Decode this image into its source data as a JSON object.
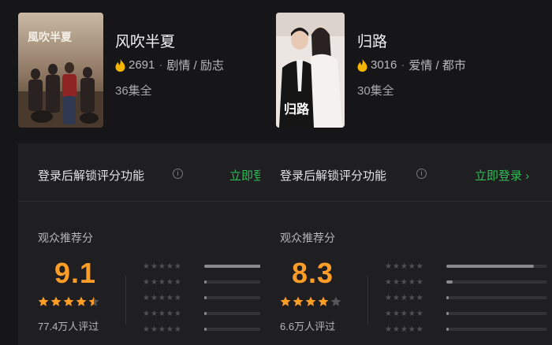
{
  "colors": {
    "accent_orange": "#ff9d26",
    "login_green": "#2fbd55",
    "background": "#161618",
    "panel": "#1f1f22"
  },
  "shows": [
    {
      "title": "风吹半夏",
      "poster_text": "風吹半夏",
      "heat": "2691",
      "genres": "剧情 / 励志",
      "episodes": "36集全"
    },
    {
      "title": "归路",
      "poster_text": "归路",
      "heat": "3016",
      "genres": "爱情 / 都市",
      "episodes": "30集全"
    }
  ],
  "panels": [
    {
      "unlock_text": "登录后解锁评分功能",
      "login_link": "立即登录",
      "rec_label": "观众推荐分",
      "score": "9.1",
      "star_rating": 4.5,
      "reviews": "77.4万人评过",
      "distribution": [
        0.92,
        0.02,
        0.01,
        0.005,
        0.005
      ]
    },
    {
      "unlock_text": "登录后解锁评分功能",
      "login_link": "立即登录 ›",
      "rec_label": "观众推荐分",
      "score": "8.3",
      "star_rating": 4,
      "reviews": "6.6万人评过",
      "distribution": [
        0.87,
        0.06,
        0.02,
        0.01,
        0.02
      ]
    }
  ],
  "icons": {
    "heat": "flame-icon",
    "info": "info-icon",
    "star": "star-icon"
  }
}
